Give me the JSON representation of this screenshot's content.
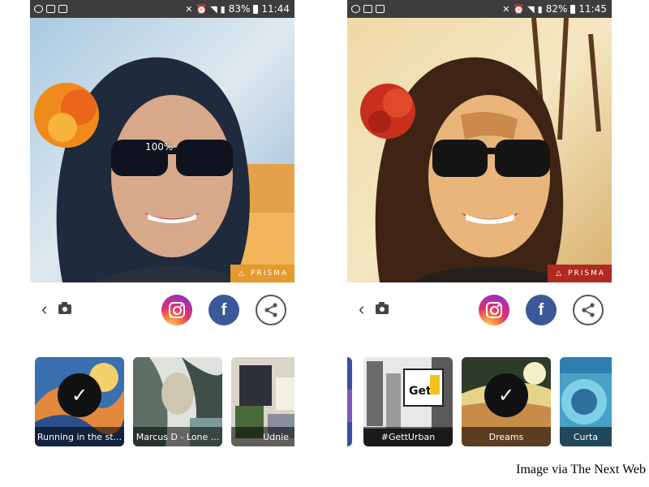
{
  "left_screen": {
    "status": {
      "battery": "83%",
      "time": "11:44"
    },
    "processing": {
      "percent": "100%"
    },
    "watermark": "PRISMA",
    "filters": [
      {
        "label": "Running in the st...",
        "selected": true
      },
      {
        "label": "Marcus D - Lone ...",
        "selected": false
      },
      {
        "label": "Udnie",
        "selected": false
      }
    ]
  },
  "right_screen": {
    "status": {
      "battery": "82%",
      "time": "11:45"
    },
    "watermark": "PRISMA",
    "filters": [
      {
        "label": "#GettUrban",
        "selected": false
      },
      {
        "label": "Dreams",
        "selected": true
      },
      {
        "label": "Curta",
        "selected": false
      }
    ]
  },
  "caption": "Image via The Next Web",
  "icons": {
    "back": "‹",
    "check": "✓",
    "facebook": "f",
    "share": "share-icon"
  },
  "colors": {
    "status_bar": "#3d3d3d",
    "left_watermark_bg": "#e49a2c",
    "right_watermark_bg": "#b02a22",
    "facebook": "#3b5998"
  }
}
